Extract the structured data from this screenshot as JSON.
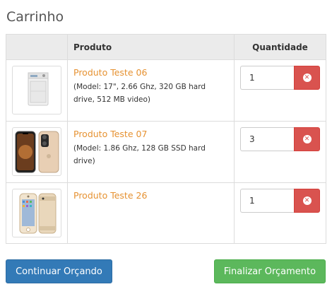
{
  "page": {
    "title": "Carrinho"
  },
  "table": {
    "headers": {
      "product": "Produto",
      "quantity": "Quantidade"
    },
    "rows": [
      {
        "name": "Produto Teste 06",
        "description": "(Model: 17\", 2.66 Ghz, 320 GB hard drive, 512 MB video)",
        "quantity": "1",
        "image_icon": "washing-machine-icon"
      },
      {
        "name": "Produto Teste 07",
        "description": "(Model: 1.86 Ghz, 128 GB SSD hard drive)",
        "quantity": "3",
        "image_icon": "smartphone-icon"
      },
      {
        "name": "Produto Teste 26",
        "description": "",
        "quantity": "1",
        "image_icon": "smartphone-icon"
      }
    ]
  },
  "actions": {
    "continue_label": "Continuar Orçando",
    "finish_label": "Finalizar Orçamento"
  },
  "colors": {
    "link": "#e69232",
    "danger": "#d9534f",
    "primary": "#337ab7",
    "success": "#5cb85c"
  }
}
